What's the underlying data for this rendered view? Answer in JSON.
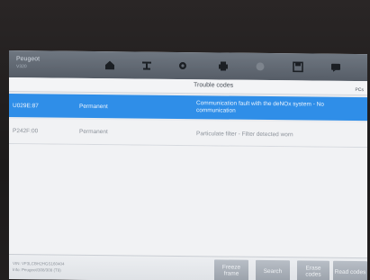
{
  "vehicle": {
    "make": "Peugeot",
    "model": "V320"
  },
  "toolbar": {
    "icons": [
      "home-icon",
      "vehicle-lift-icon",
      "gear-icon",
      "printer-icon",
      "record-icon",
      "save-icon",
      "message-icon"
    ]
  },
  "table": {
    "title": "Trouble codes",
    "unit": "PCs",
    "rows": [
      {
        "code": "U029E:87",
        "status": "Permanent",
        "description": "Communication fault with the deNOx system - No communication"
      },
      {
        "code": "P242F:00",
        "status": "Permanent",
        "description": "Particulate filter - Filter detected worn"
      }
    ]
  },
  "footer": {
    "vin": "VIN: VF3LCBH2HGS160404",
    "info": "Info: Peugeot/308/308 (T9)",
    "buttons": {
      "freeze_frame": "Freeze frame",
      "search": "Search",
      "erase_codes": "Erase codes",
      "read_codes": "Read codes"
    }
  },
  "colors": {
    "accent": "#2f8ee8",
    "toolbar": "#5f6670"
  }
}
